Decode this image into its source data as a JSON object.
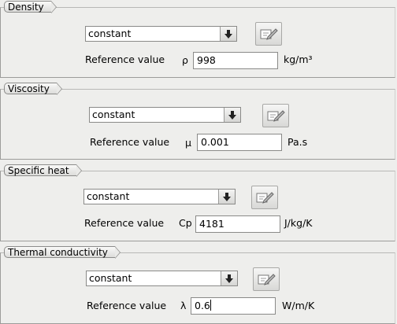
{
  "sections": [
    {
      "title": "Density",
      "method": "constant",
      "ref_label": "Reference value",
      "symbol": "ρ",
      "value": "998",
      "unit": "kg/m³"
    },
    {
      "title": "Viscosity",
      "method": "constant",
      "ref_label": "Reference value",
      "symbol": "µ",
      "value": "0.001",
      "unit": "Pa.s"
    },
    {
      "title": "Specific heat",
      "method": "constant",
      "ref_label": "Reference value",
      "symbol": "Cp",
      "value": "4181",
      "unit": "J/kg/K"
    },
    {
      "title": "Thermal conductivity",
      "method": "constant",
      "ref_label": "Reference value",
      "symbol": "λ",
      "value": "0.6",
      "unit": "W/m/K"
    }
  ],
  "icons": {
    "dropdown": "arrow-down-icon",
    "edit": "edit-formula-icon"
  }
}
